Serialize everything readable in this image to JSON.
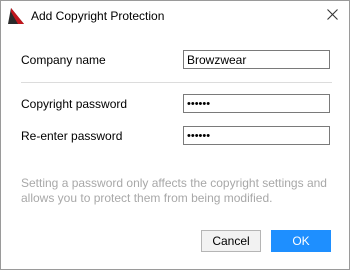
{
  "window": {
    "title": "Add Copyright Protection",
    "app_icon": "browzwear-logo-icon",
    "close_icon": "close-icon"
  },
  "form": {
    "company_label": "Company name",
    "company_value": "Browzwear",
    "password_label": "Copyright password",
    "password_value": "••••••",
    "reenter_label": "Re-enter password",
    "reenter_value": "••••••"
  },
  "hint": "Setting a password only affects the copyright settings and allows you to protect them from being modified.",
  "buttons": {
    "cancel": "Cancel",
    "ok": "OK"
  },
  "colors": {
    "accent": "#1e8fff",
    "logo_red": "#c0161d",
    "logo_dark": "#2a2a2a",
    "hint_text": "#a8a8a8"
  }
}
